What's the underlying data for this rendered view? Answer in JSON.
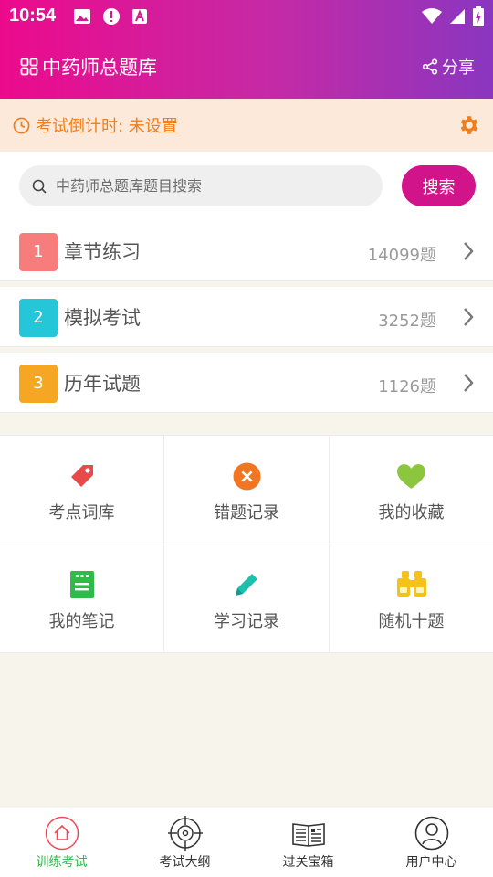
{
  "status_bar": {
    "time": "10:54"
  },
  "header": {
    "title": "中药师总题库",
    "share_label": "分享"
  },
  "countdown": {
    "text": "考试倒计时: 未设置"
  },
  "search": {
    "placeholder": "中药师总题库题目搜索",
    "button_label": "搜索"
  },
  "list": [
    {
      "number": "1",
      "label": "章节练习",
      "count": "14099题",
      "color": "#f77d7d"
    },
    {
      "number": "2",
      "label": "模拟考试",
      "count": "3252题",
      "color": "#25c6d8"
    },
    {
      "number": "3",
      "label": "历年试题",
      "count": "1126题",
      "color": "#f5a623"
    }
  ],
  "grid": [
    {
      "label": "考点词库",
      "icon": "tag-icon",
      "color": "#e84a4a"
    },
    {
      "label": "错题记录",
      "icon": "close-circle-icon",
      "color": "#f07624"
    },
    {
      "label": "我的收藏",
      "icon": "heart-icon",
      "color": "#8cc63f"
    },
    {
      "label": "我的笔记",
      "icon": "notebook-icon",
      "color": "#2fba4a"
    },
    {
      "label": "学习记录",
      "icon": "pencil-icon",
      "color": "#1fbfae"
    },
    {
      "label": "随机十题",
      "icon": "binoculars-icon",
      "color": "#f5c21b"
    }
  ],
  "tabs": [
    {
      "label": "训练考试",
      "icon": "home-icon",
      "active": true
    },
    {
      "label": "考试大纲",
      "icon": "target-icon",
      "active": false
    },
    {
      "label": "过关宝箱",
      "icon": "news-book-icon",
      "active": false
    },
    {
      "label": "用户中心",
      "icon": "user-icon",
      "active": false
    }
  ],
  "colors": {
    "accent": "#d1148a",
    "countdown_text": "#f07e1c",
    "active_tab": "#2fba4a"
  }
}
